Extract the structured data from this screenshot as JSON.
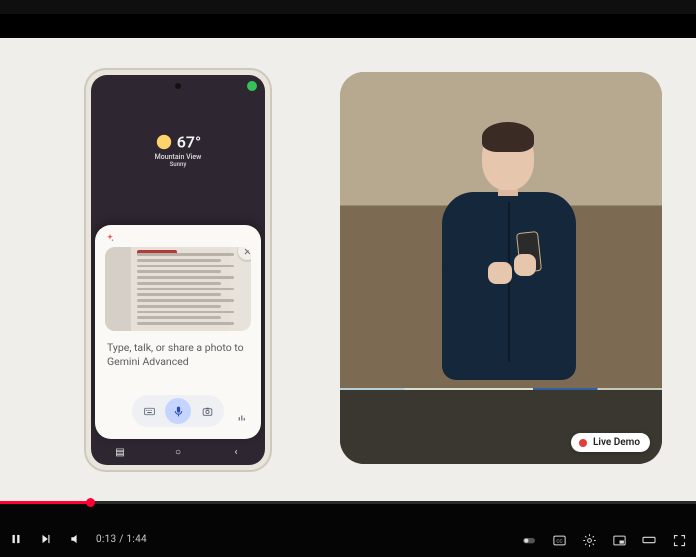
{
  "player": {
    "time_current": "0:13",
    "time_total": "1:44",
    "progress_pct": 13
  },
  "phone": {
    "weather": {
      "temp": "67°",
      "line1": "Mountain View",
      "line2": "Sunny"
    },
    "sheet": {
      "placeholder": "Type, talk, or share a photo to Gemini Advanced",
      "close_icon": "close-icon",
      "spark_icon": "sparkle-icon",
      "keyboard_icon": "keyboard-icon",
      "mic_icon": "microphone-icon",
      "camera_icon": "camera-icon",
      "eq_icon": "equalizer-icon"
    },
    "nav": {
      "recents": "recents-icon",
      "home": "home-icon",
      "back": "back-icon"
    }
  },
  "live": {
    "badge": "Live Demo"
  },
  "controls": {
    "play": "pause-icon",
    "next": "next-icon",
    "volume": "volume-icon",
    "right": {
      "autoplay": "autoplay-toggle",
      "cc": "closed-captions-icon",
      "settings": "gear-icon",
      "pip": "miniplayer-icon",
      "theater": "theater-icon",
      "fullscreen": "fullscreen-icon"
    }
  }
}
